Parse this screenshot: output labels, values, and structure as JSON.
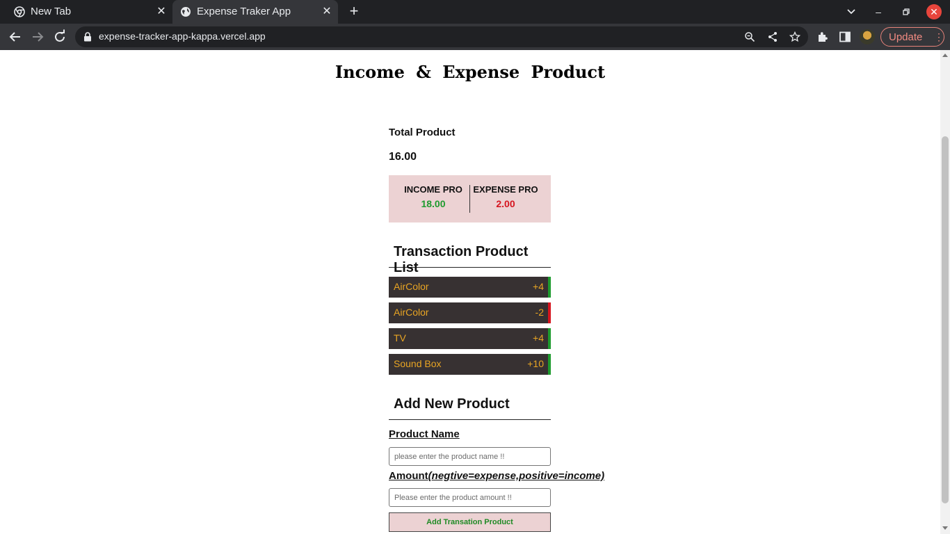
{
  "browser": {
    "tabs": [
      {
        "title": "New Tab",
        "active": false
      },
      {
        "title": "Expense Traker App",
        "active": true
      }
    ],
    "url": "expense-tracker-app-kappa.vercel.app",
    "update_label": "Update"
  },
  "app": {
    "title": "Income & Expense Product",
    "total_label": "Total Product",
    "total_value": "16.00",
    "income": {
      "label": "INCOME PRO",
      "value": "18.00",
      "color": "#1e9b2e"
    },
    "expense": {
      "label": "EXPENSE PRO",
      "value": "2.00",
      "color": "#d6151f"
    },
    "list_heading": "Transaction Product List",
    "transactions": [
      {
        "name": "AirColor",
        "amount": "+4",
        "type": "income"
      },
      {
        "name": "AirColor",
        "amount": "-2",
        "type": "expense"
      },
      {
        "name": "TV",
        "amount": "+4",
        "type": "income"
      },
      {
        "name": "Sound Box",
        "amount": "+10",
        "type": "income"
      }
    ],
    "add_heading": "Add New Product",
    "form": {
      "name_label": "Product Name",
      "name_placeholder": "please enter the product name !!",
      "amount_label": "Amount",
      "amount_hint": "(negtive=expense,positive=income)",
      "amount_placeholder": "Please enter the product amount !!",
      "submit_label": "Add Transation Product"
    }
  },
  "colors": {
    "income_bar": "#1e9b2e",
    "expense_bar": "#d6151f",
    "list_bg": "#373132",
    "list_text": "#e9a523",
    "card_bg": "#ecd2d3"
  }
}
